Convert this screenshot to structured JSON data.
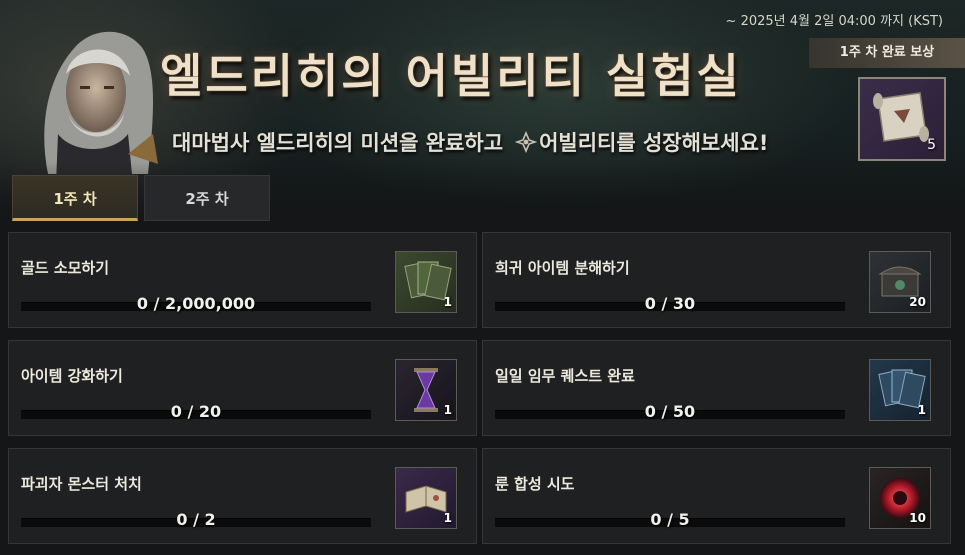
{
  "event": {
    "deadline": "~ 2025년 4월 2일 04:00 까지 (KST)",
    "title": "엘드리히의 어빌리티 실험실",
    "subtitle_before": "대마법사 엘드리히의 미션을 완료하고",
    "subtitle_after": "어빌리티를 성장해보세요!",
    "reward_label": "1주 차 완료 보상",
    "reward_count": "5",
    "reward_icon": "scroll-icon"
  },
  "tabs": [
    {
      "label": "1주 차",
      "active": true
    },
    {
      "label": "2주 차",
      "active": false
    }
  ],
  "missions": [
    {
      "label": "골드 소모하기",
      "progress": "0 / 2,000,000",
      "count": "1",
      "icon": "card-pack-green-icon",
      "fraction": 0
    },
    {
      "label": "희귀 아이템 분해하기",
      "progress": "0 / 30",
      "count": "20",
      "icon": "chest-icon",
      "fraction": 0
    },
    {
      "label": "아이템 강화하기",
      "progress": "0 / 20",
      "count": "1",
      "icon": "hourglass-icon",
      "fraction": 0
    },
    {
      "label": "일일 임무 퀘스트 완료",
      "progress": "0 / 50",
      "count": "1",
      "icon": "card-pack-blue-icon",
      "fraction": 0
    },
    {
      "label": "파괴자 몬스터 처치",
      "progress": "0 / 2",
      "count": "1",
      "icon": "book-icon",
      "fraction": 0
    },
    {
      "label": "룬 합성 시도",
      "progress": "0 / 5",
      "count": "10",
      "icon": "red-orb-icon",
      "fraction": 0
    }
  ]
}
